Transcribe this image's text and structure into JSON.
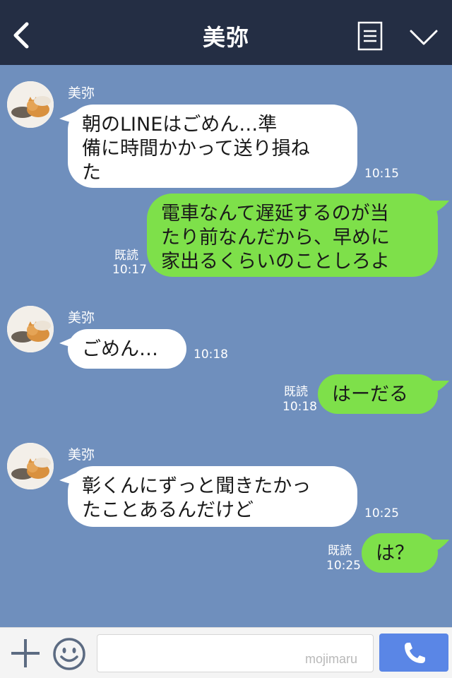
{
  "header": {
    "title": "美弥",
    "back_icon": "chevron-left-icon",
    "menu_icon": "menu-list-icon",
    "collapse_icon": "chevron-down-icon",
    "bg": "#242e44"
  },
  "chat": {
    "bg": "#6f8fbd",
    "incoming_color": "#ffffff",
    "outgoing_color": "#7ee04a",
    "messages": [
      {
        "direction": "in",
        "sender": "美弥",
        "lines": [
          "朝のLINEはごめん…準",
          "備に時間かかって送り損ね",
          "た"
        ],
        "time": "10:15"
      },
      {
        "direction": "out",
        "lines": [
          "電車なんて遅延するのが当",
          "たり前なんだから、早めに",
          "家出るくらいのことしろよ"
        ],
        "read": "既読",
        "time": "10:17"
      },
      {
        "direction": "in",
        "sender": "美弥",
        "lines": [
          "ごめん…"
        ],
        "time": "10:18"
      },
      {
        "direction": "out",
        "lines": [
          "はーだる"
        ],
        "read": "既読",
        "time": "10:18"
      },
      {
        "direction": "in",
        "sender": "美弥",
        "lines": [
          "彰くんにずっと聞きたかっ",
          "たことあるんだけど"
        ],
        "time": "10:25"
      },
      {
        "direction": "out",
        "lines": [
          "は？"
        ],
        "read": "既読",
        "time": "10:25"
      }
    ]
  },
  "input_bar": {
    "plus_icon": "plus-icon",
    "emoji_icon": "smiley-icon",
    "input_value": "",
    "call_icon": "phone-icon",
    "call_color": "#5a86e6",
    "watermark": "mojimaru"
  }
}
